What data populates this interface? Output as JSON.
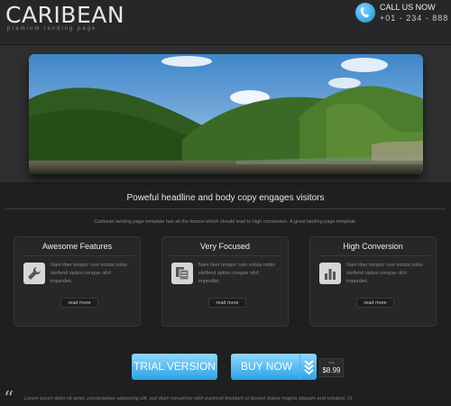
{
  "header": {
    "logo": "CARIBEAN",
    "tagline": "premium landing page",
    "call_label": "CALL US NOW",
    "phone": "+01 - 234 - 888"
  },
  "main": {
    "headline": "Poweful headline and body copy engages visitors",
    "subline": "Caribean landing page template has all the factors which should lead to high conversion. A great landing page template."
  },
  "features": [
    {
      "title": "Awesome Features",
      "icon": "wrench-icon",
      "text": "Nam liber tempor cum soluta nobis eleifend option congue nihil imperdiet.",
      "read_more": "read more"
    },
    {
      "title": "Very Focused",
      "icon": "documents-icon",
      "text": "Nam liber tempor cum soluta nobis eleifend option congue nihil imperdiet.",
      "read_more": "read more"
    },
    {
      "title": "High Conversion",
      "icon": "bar-chart-icon",
      "text": "Nam liber tempor cum soluta nobis eleifend option congue nihil imperdiet.",
      "read_more": "read more"
    }
  ],
  "cta": {
    "trial_label": "TRIAL VERSION",
    "buy_label": "BUY NOW",
    "price_label": "only",
    "price": "$8.99"
  },
  "testimonial": {
    "quote_mark": "“",
    "text": "Lorem ipsum dolor sit amet, consectetuer adipiscing elit, sed diam nonummy nibh euismod tincidunt ut laoreet dolore magna aliquam erat volutpat. Ut"
  },
  "colors": {
    "accent": "#2aa3e6",
    "background": "#1e1f20"
  }
}
